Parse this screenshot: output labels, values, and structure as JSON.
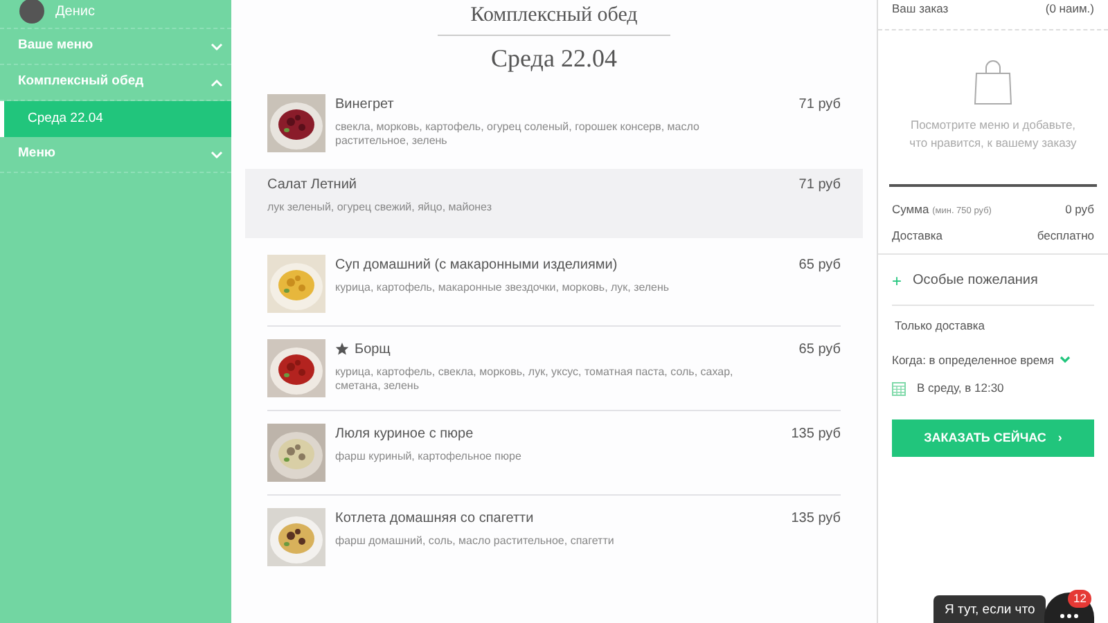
{
  "sidebar": {
    "user": {
      "name": "Денис"
    },
    "items": [
      {
        "label": "Ваше меню",
        "expanded": false
      },
      {
        "label": "Комплексный обед",
        "expanded": true,
        "children": [
          {
            "label": "Среда 22.04",
            "selected": true
          }
        ]
      },
      {
        "label": "Меню",
        "expanded": false
      }
    ]
  },
  "menu": {
    "title": "Комплексный обед",
    "day": "Среда 22.04",
    "dishes": [
      {
        "name": "Винегрет",
        "description": "свекла, морковь, картофель, огурец соленый, горошек консерв, масло растительное, зелень",
        "price": "71 руб",
        "starred": false,
        "highlighted": false,
        "kind": "picture"
      },
      {
        "name": "Салат Летний",
        "description": "лук зеленый, огурец свежий, яйцо, майонез",
        "price": "71 руб",
        "starred": false,
        "highlighted": true
      },
      {
        "name": "Суп домашний (с макаронными изделиями)",
        "description": "курица, картофель, макаронные звездочки, морковь, лук, зелень",
        "price": "65 руб",
        "starred": false,
        "highlighted": false,
        "kind": "picture"
      },
      {
        "name": "Борщ",
        "description": "курица, картофель, свекла, морковь, лук, уксус, томатная паста, соль, сахар, сметана, зелень",
        "price": "65 руб",
        "starred": true,
        "highlighted": false,
        "kind": "picture"
      },
      {
        "name": "Люля куриное с пюре",
        "description": "фарш куриный, картофельное пюре",
        "price": "135 руб",
        "starred": false,
        "highlighted": false,
        "kind": "picture"
      },
      {
        "name": "Котлета домашняя со спагетти",
        "description": "фарш домашний, соль, масло растительное, спагетти",
        "price": "135 руб",
        "starred": false,
        "highlighted": false,
        "kind": "picture"
      }
    ]
  },
  "order": {
    "title": "Ваш заказ",
    "count": "(0 наим.)",
    "empty_text": "Посмотрите меню и добавьте, что нравится, к вашему заказу",
    "sum_label": "Сумма",
    "sum_min": "(мин. 750 руб)",
    "sum_value": "0 руб",
    "delivery_label": "Доставка",
    "delivery_value": "бесплатно",
    "wishes": "Особые пожелания",
    "wishes_icon": "+",
    "delivery_mode": "Только доставка",
    "when": "Когда: в определенное время",
    "date": "В среду, в 12:30",
    "button": "ЗАКАЗАТЬ СЕЙЧАС",
    "button_icon": "›"
  },
  "chat": {
    "tooltip": "Я тут, если что",
    "badge": "12"
  }
}
